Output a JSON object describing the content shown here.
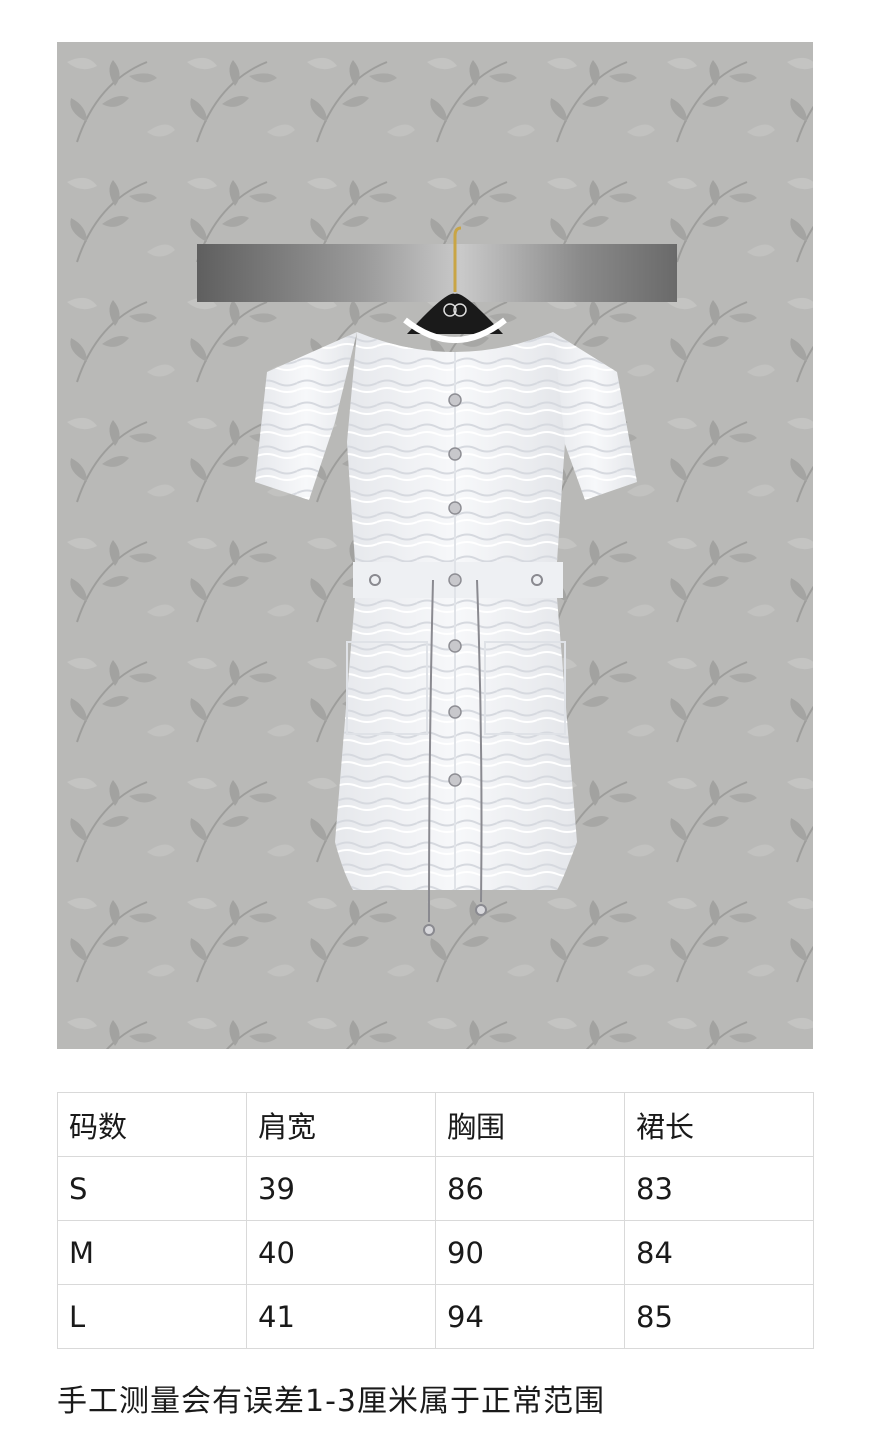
{
  "product_photo": {
    "subject": "white tweed short-sleeve dress with chain belt on hanger",
    "hanger_logo": "CC"
  },
  "size_table": {
    "headers": [
      "码数",
      "肩宽",
      "胸围",
      "裙长"
    ],
    "rows": [
      [
        "S",
        "39",
        "86",
        "83"
      ],
      [
        "M",
        "40",
        "90",
        "84"
      ],
      [
        "L",
        "41",
        "94",
        "85"
      ]
    ]
  },
  "note": "手工测量会有误差1-3厘米属于正常范围",
  "colors": {
    "wall": "#b9b9b7",
    "dress": "#f2f3f5",
    "rail": "#8c8c8c",
    "border": "#d9d9d9"
  }
}
